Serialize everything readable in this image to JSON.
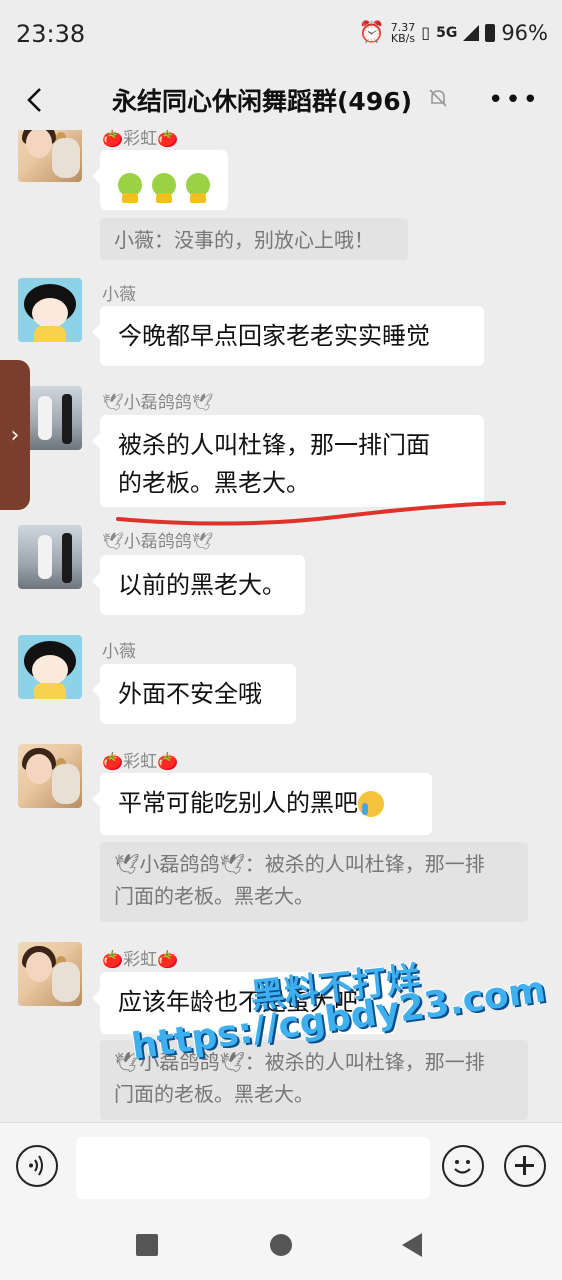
{
  "status_bar": {
    "time": "23:38",
    "net_speed_value": "7.37",
    "net_speed_unit": "KB/s",
    "network": "5G",
    "battery": "96%"
  },
  "header": {
    "title": "永结同心休闲舞蹈群(496)"
  },
  "messages": [
    {
      "sender": "🍅彩虹🍅",
      "text": ""
    },
    {
      "quote": "小薇：没事的，别放心上哦！"
    },
    {
      "sender": "小薇",
      "text": "今晚都早点回家老老实实睡觉"
    },
    {
      "sender": "🕊小磊鸽鸽🕊",
      "text_line1": "被杀的人叫杜锋，那一排门面",
      "text_line2": "的老板。黑老大。"
    },
    {
      "sender": "🕊小磊鸽鸽🕊",
      "text": "以前的黑老大。"
    },
    {
      "sender": "小薇",
      "text": "外面不安全哦"
    },
    {
      "sender": "🍅彩虹🍅",
      "text": "平常可能吃别人的黑吧",
      "quote_line1": "🕊小磊鸽鸽🕊：被杀的人叫杜锋，那一排",
      "quote_line2": "门面的老板。黑老大。"
    },
    {
      "sender": "🍅彩虹🍅",
      "text": "应该年龄也不是蛮大吧",
      "quote_line1": "🕊小磊鸽鸽🕊：被杀的人叫杜锋，那一排",
      "quote_line2": "门面的老板。黑老大。"
    }
  ],
  "watermark": {
    "line1": "黑料不打烊",
    "line2": "https://cgbdy23.com"
  },
  "icons": {
    "back": "chevron-left-icon",
    "mute": "bell-off-icon",
    "more": "more-horizontal-icon",
    "voice": "voice-icon",
    "emoji": "smile-icon",
    "plus": "plus-icon"
  },
  "colors": {
    "background": "#ededed",
    "bubble": "#ffffff",
    "quote": "#e3e3e3",
    "underline": "#e0322a",
    "watermark": "#3eb0f0"
  }
}
